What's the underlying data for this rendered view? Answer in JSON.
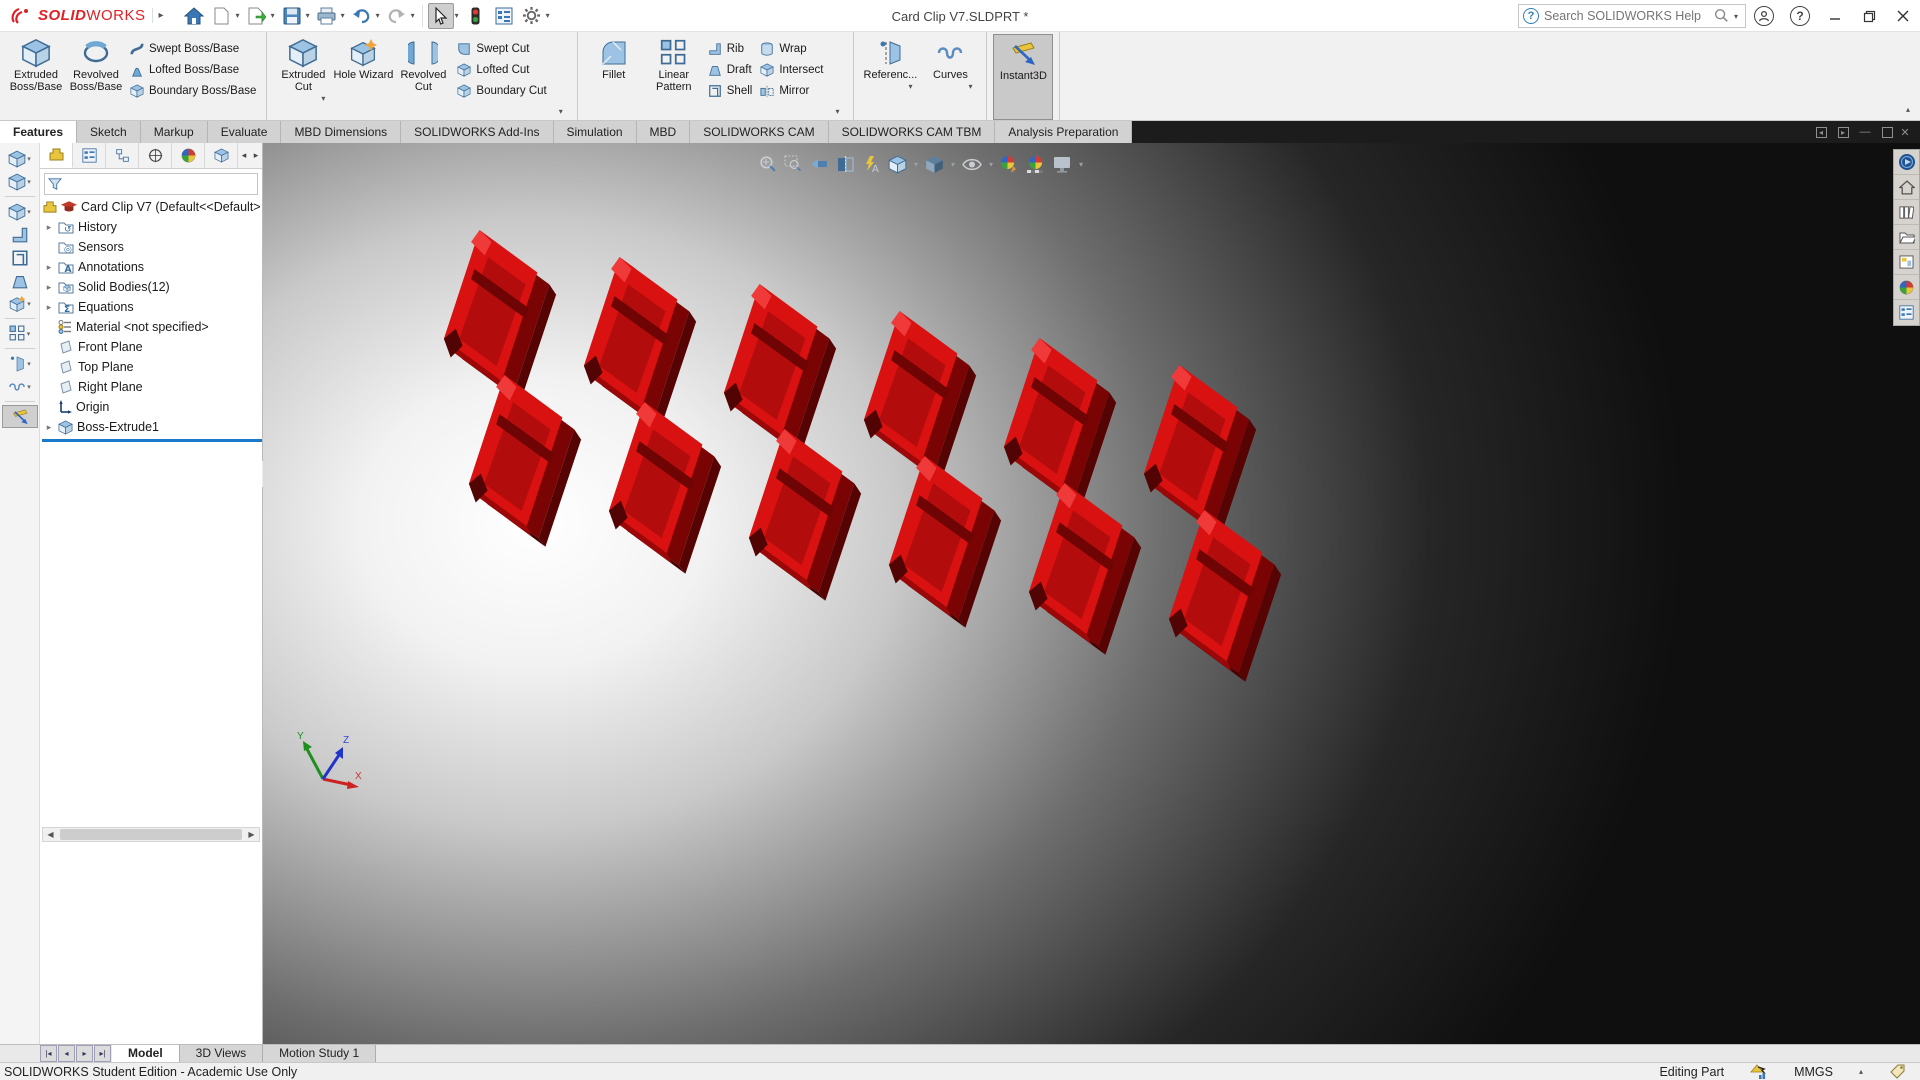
{
  "titlebar": {
    "logo_bold": "SOLID",
    "logo_light": "WORKS",
    "document_title": "Card Clip V7.SLDPRT *",
    "search_placeholder": "Search SOLIDWORKS Help",
    "help_glyph": "?"
  },
  "ribbon": {
    "tabs": [
      {
        "label": "Features",
        "active": true
      },
      {
        "label": "Sketch"
      },
      {
        "label": "Markup"
      },
      {
        "label": "Evaluate"
      },
      {
        "label": "MBD Dimensions"
      },
      {
        "label": "SOLIDWORKS Add-Ins"
      },
      {
        "label": "Simulation"
      },
      {
        "label": "MBD"
      },
      {
        "label": "SOLIDWORKS CAM"
      },
      {
        "label": "SOLIDWORKS CAM TBM"
      },
      {
        "label": "Analysis Preparation"
      }
    ],
    "buttons": {
      "extruded_boss_base": "Extruded Boss/Base",
      "revolved_boss_base": "Revolved Boss/Base",
      "swept_boss_base": "Swept Boss/Base",
      "lofted_boss_base": "Lofted Boss/Base",
      "boundary_boss_base": "Boundary Boss/Base",
      "extruded_cut": "Extruded Cut",
      "hole_wizard": "Hole Wizard",
      "revolved_cut": "Revolved Cut",
      "swept_cut": "Swept Cut",
      "lofted_cut": "Lofted Cut",
      "boundary_cut": "Boundary Cut",
      "fillet": "Fillet",
      "linear_pattern": "Linear Pattern",
      "rib": "Rib",
      "draft": "Draft",
      "shell": "Shell",
      "wrap": "Wrap",
      "intersect": "Intersect",
      "mirror": "Mirror",
      "reference_geometry": "Referenc...",
      "curves": "Curves",
      "instant3d": "Instant3D"
    }
  },
  "feature_tree": {
    "root_label": "Card Clip V7  (Default<<Default>",
    "items": [
      {
        "label": "History",
        "expandable": true
      },
      {
        "label": "Sensors",
        "expandable": false
      },
      {
        "label": "Annotations",
        "expandable": true
      },
      {
        "label": "Solid Bodies(12)",
        "expandable": true
      },
      {
        "label": "Equations",
        "expandable": true
      },
      {
        "label": "Material <not specified>",
        "expandable": false
      },
      {
        "label": "Front Plane",
        "expandable": false
      },
      {
        "label": "Top Plane",
        "expandable": false
      },
      {
        "label": "Right Plane",
        "expandable": false
      },
      {
        "label": "Origin",
        "expandable": false
      },
      {
        "label": "Boss-Extrude1",
        "expandable": true
      }
    ]
  },
  "viewport": {
    "solid_body_count": 12,
    "triad": {
      "x": "X",
      "y": "Y",
      "z": "Z"
    }
  },
  "doc_tabs": [
    {
      "label": "Model",
      "active": true
    },
    {
      "label": "3D Views"
    },
    {
      "label": "Motion Study 1"
    }
  ],
  "statusbar": {
    "message": "SOLIDWORKS Student Edition - Academic Use Only",
    "mode": "Editing Part",
    "units": "MMGS"
  },
  "colors": {
    "logo_red": "#e12026",
    "clip_red": "#d91111",
    "selection_blue": "#1a79c9"
  }
}
